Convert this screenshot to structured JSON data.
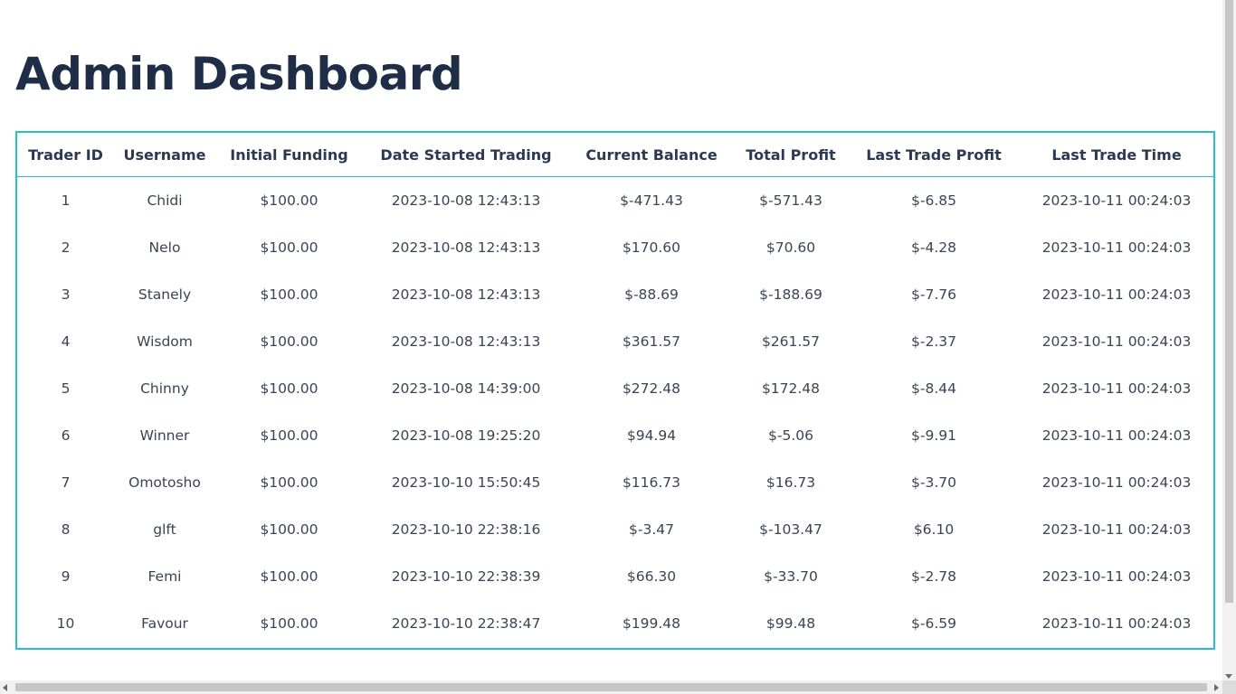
{
  "page": {
    "title": "Admin Dashboard"
  },
  "colors": {
    "title": "#1f2d46",
    "table_border": "#26c0c0",
    "header_text": "#2b3a52",
    "cell_text": "#3a4454"
  },
  "table": {
    "columns": [
      "Trader ID",
      "Username",
      "Initial Funding",
      "Date Started Trading",
      "Current Balance",
      "Total Profit",
      "Last Trade Profit",
      "Last Trade Time"
    ],
    "rows": [
      [
        "1",
        "Chidi",
        "$100.00",
        "2023-10-08 12:43:13",
        "$-471.43",
        "$-571.43",
        "$-6.85",
        "2023-10-11 00:24:03"
      ],
      [
        "2",
        "Nelo",
        "$100.00",
        "2023-10-08 12:43:13",
        "$170.60",
        "$70.60",
        "$-4.28",
        "2023-10-11 00:24:03"
      ],
      [
        "3",
        "Stanely",
        "$100.00",
        "2023-10-08 12:43:13",
        "$-88.69",
        "$-188.69",
        "$-7.76",
        "2023-10-11 00:24:03"
      ],
      [
        "4",
        "Wisdom",
        "$100.00",
        "2023-10-08 12:43:13",
        "$361.57",
        "$261.57",
        "$-2.37",
        "2023-10-11 00:24:03"
      ],
      [
        "5",
        "Chinny",
        "$100.00",
        "2023-10-08 14:39:00",
        "$272.48",
        "$172.48",
        "$-8.44",
        "2023-10-11 00:24:03"
      ],
      [
        "6",
        "Winner",
        "$100.00",
        "2023-10-08 19:25:20",
        "$94.94",
        "$-5.06",
        "$-9.91",
        "2023-10-11 00:24:03"
      ],
      [
        "7",
        "Omotosho",
        "$100.00",
        "2023-10-10 15:50:45",
        "$116.73",
        "$16.73",
        "$-3.70",
        "2023-10-11 00:24:03"
      ],
      [
        "8",
        "glft",
        "$100.00",
        "2023-10-10 22:38:16",
        "$-3.47",
        "$-103.47",
        "$6.10",
        "2023-10-11 00:24:03"
      ],
      [
        "9",
        "Femi",
        "$100.00",
        "2023-10-10 22:38:39",
        "$66.30",
        "$-33.70",
        "$-2.78",
        "2023-10-11 00:24:03"
      ],
      [
        "10",
        "Favour",
        "$100.00",
        "2023-10-10 22:38:47",
        "$199.48",
        "$99.48",
        "$-6.59",
        "2023-10-11 00:24:03"
      ]
    ]
  }
}
